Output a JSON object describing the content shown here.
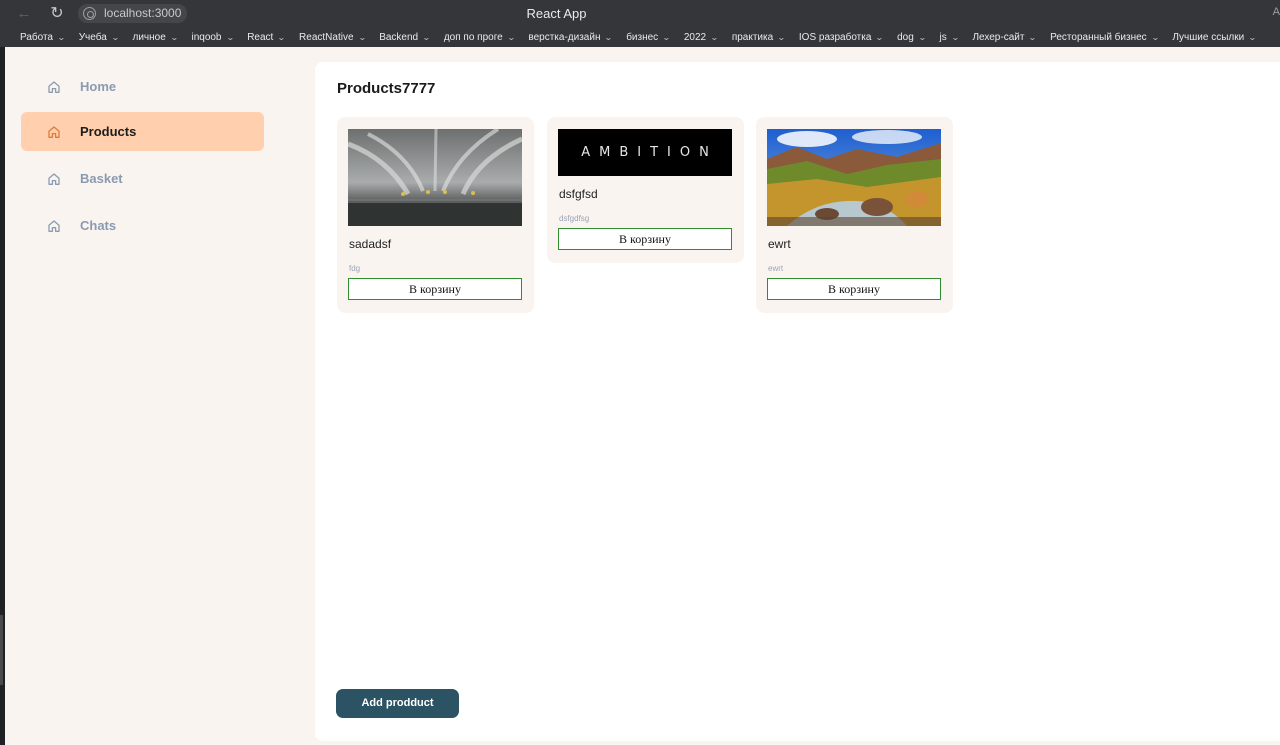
{
  "browser": {
    "url": "localhost:3000",
    "window_title": "React App",
    "profile_initial": "A",
    "bookmarks": [
      "Работа",
      "Учеба",
      "личное",
      "inqoob",
      "React",
      "ReactNative",
      "Backend",
      "доп по проге",
      "верстка-дизайн",
      "бизнес",
      "2022",
      "практика",
      "IOS разработка",
      "dog",
      "js",
      "Лехер-сайт",
      "Ресторанный бизнес",
      "Лучшие ссылки"
    ]
  },
  "sidebar": {
    "items": [
      {
        "label": "Home",
        "icon": "home-icon",
        "active": false
      },
      {
        "label": "Products",
        "icon": "home-icon",
        "active": true
      },
      {
        "label": "Basket",
        "icon": "home-icon",
        "active": false
      },
      {
        "label": "Chats",
        "icon": "home-icon",
        "active": false
      }
    ]
  },
  "main": {
    "title": "Products7777",
    "add_button_label": "Add prodduct",
    "products": [
      {
        "name": "sadadsf",
        "description": "fdg",
        "button_label": "В корзину",
        "image": "fountain-water-jets"
      },
      {
        "name": "dsfgfsd",
        "description": "dsfgdfsg",
        "button_label": "В корзину",
        "image": "ambition-logo",
        "image_text": "AMBITION"
      },
      {
        "name": "ewrt",
        "description": "ewrt",
        "button_label": "В корзину",
        "image": "mountain-landscape"
      }
    ]
  },
  "colors": {
    "sidebar_active_bg": "#ffcfae",
    "app_bg": "#faf4f1",
    "button_border": "#2f8f2f",
    "add_button_bg": "#2c5363",
    "inactive_label": "#8a9bb0"
  }
}
